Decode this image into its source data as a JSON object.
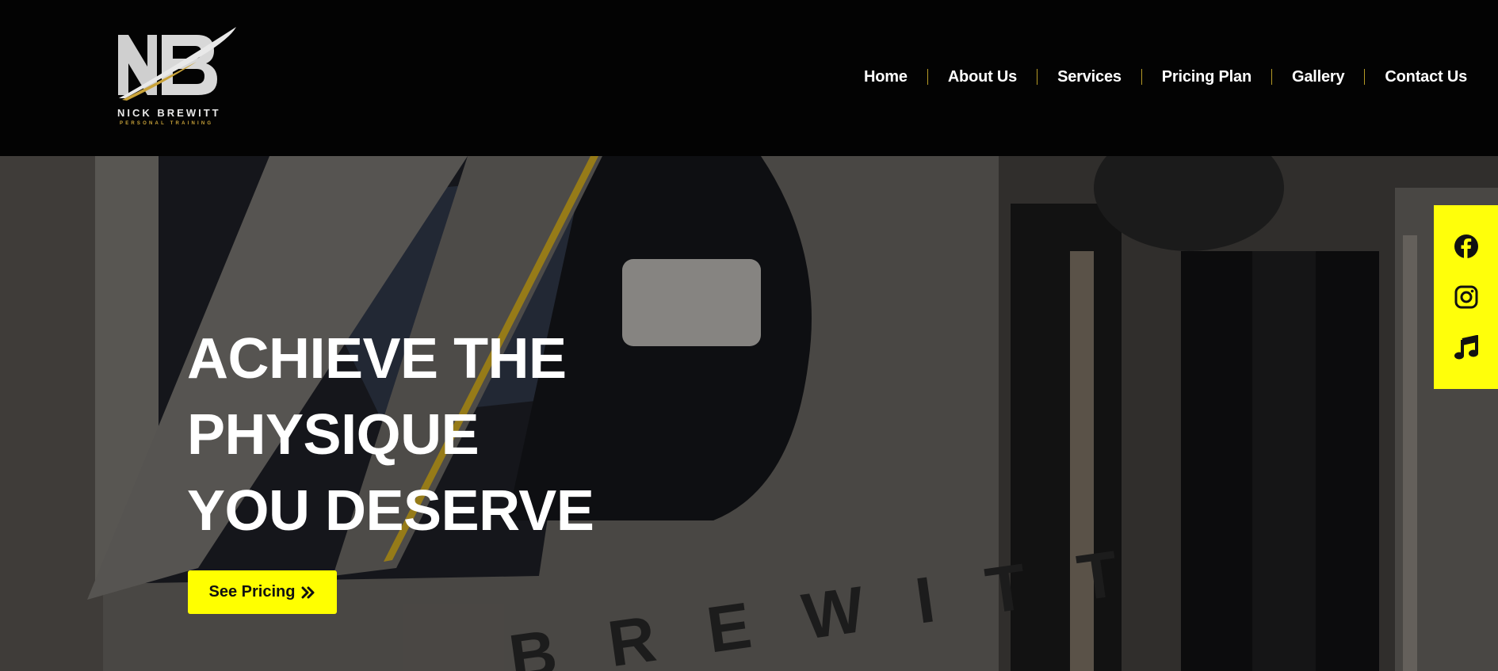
{
  "brand": {
    "name": "NICK BREWITT",
    "tagline": "PERSONAL TRAINING",
    "accent": "#c9a33a"
  },
  "nav": {
    "items": [
      {
        "label": "Home"
      },
      {
        "label": "About Us"
      },
      {
        "label": "Services"
      },
      {
        "label": "Pricing Plan"
      },
      {
        "label": "Gallery"
      },
      {
        "label": "Contact Us"
      }
    ]
  },
  "hero": {
    "title_lines": [
      "ACHIEVE THE",
      "PHYSIQUE",
      "YOU DESERVE"
    ],
    "background_wall_text": "BREWITT",
    "cta_label": "See Pricing",
    "cta_icon": "double-chevron-right-icon",
    "cta_color": "#ffff00"
  },
  "social": {
    "color": "#ffff0a",
    "links": [
      {
        "icon": "facebook-icon"
      },
      {
        "icon": "instagram-icon"
      },
      {
        "icon": "tiktok-music-icon"
      }
    ]
  }
}
